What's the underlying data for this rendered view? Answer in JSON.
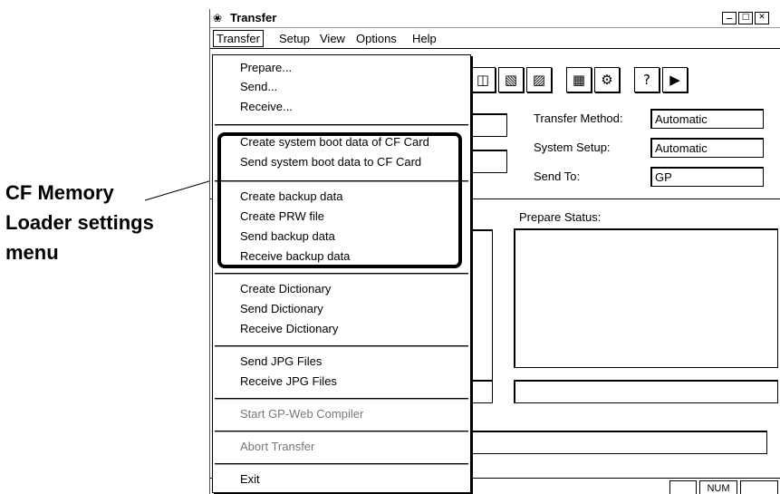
{
  "caption": {
    "text": "CF Memory\nLoader settings\nmenu"
  },
  "window": {
    "title": "Transfer",
    "icon": "transfer-app-icon",
    "buttons": [
      "minimize-icon",
      "maximize-icon",
      "close-icon"
    ]
  },
  "menubar": {
    "items": [
      "Transfer",
      "Setup",
      "View",
      "Options",
      "Help"
    ]
  },
  "toolbar": {
    "icons": [
      "prepare-icon",
      "send-icon",
      "receive-icon",
      "compare-icon",
      "settings-icon",
      "help-icon",
      "exit-icon"
    ]
  },
  "settings": {
    "transfer_method_label": "Transfer Method:",
    "transfer_method_value": "Automatic",
    "system_setup_label": "System Setup:",
    "system_setup_value": "Automatic",
    "send_to_label": "Send To:",
    "send_to_value": "GP"
  },
  "prepare_status": {
    "label": "Prepare Status:"
  },
  "statusbar": {
    "num": "NUM"
  },
  "transfer_menu": {
    "items": [
      "Prepare...",
      "Send...",
      "Receive...",
      "Create system boot data of CF Card",
      "Send system boot data to CF Card",
      "Create backup data",
      "Create PRW file",
      "Send backup data",
      "Receive backup data",
      "Create Dictionary",
      "Send Dictionary",
      "Receive Dictionary",
      "Send JPG Files",
      "Receive JPG Files",
      "Start GP-Web Compiler",
      "Abort Transfer",
      "Exit"
    ]
  }
}
